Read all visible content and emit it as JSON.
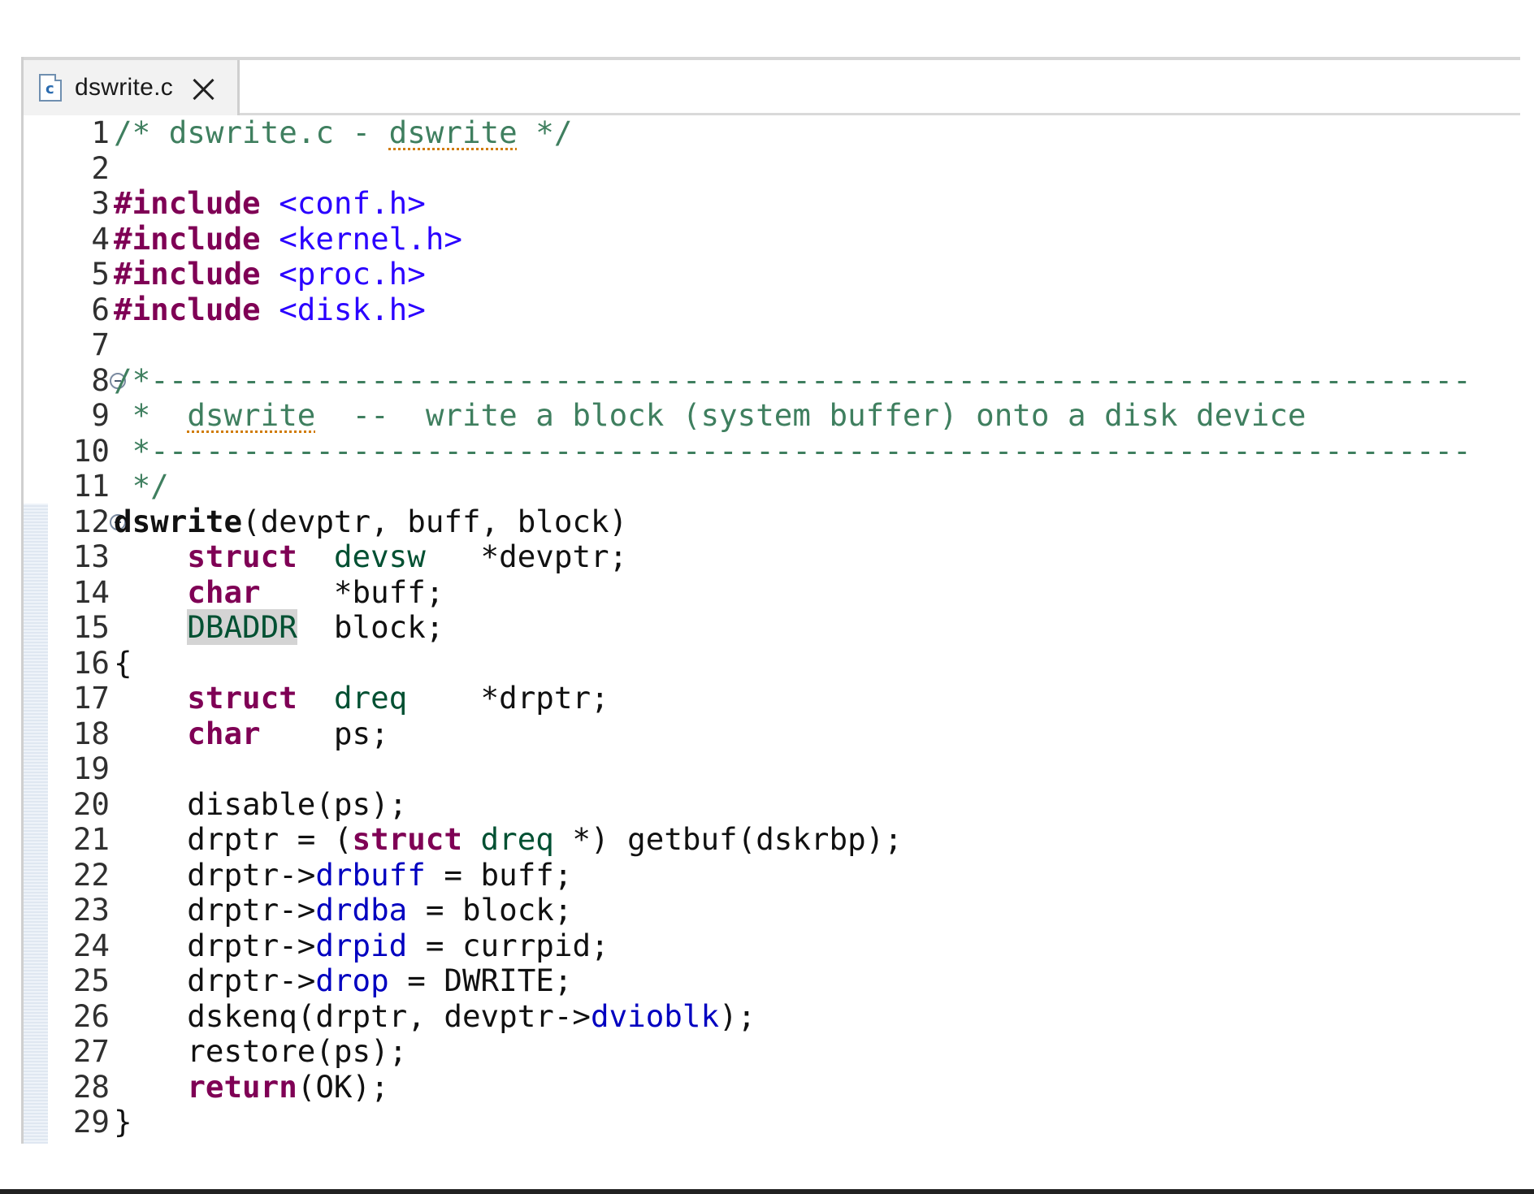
{
  "tab": {
    "filename": "dswrite.c",
    "icon": "c-source-file-icon",
    "close_icon": "close-icon"
  },
  "code": {
    "lines": [
      {
        "n": "1",
        "fold": false,
        "segs": [
          {
            "c": "cm",
            "t": "/* dswrite.c - "
          },
          {
            "c": "cm squig",
            "t": "dswrite"
          },
          {
            "c": "cm",
            "t": " */"
          }
        ]
      },
      {
        "n": "2",
        "fold": false,
        "segs": []
      },
      {
        "n": "3",
        "fold": false,
        "segs": [
          {
            "c": "kw",
            "t": "#include"
          },
          {
            "c": "",
            "t": " "
          },
          {
            "c": "inc",
            "t": "<conf.h>"
          }
        ]
      },
      {
        "n": "4",
        "fold": false,
        "segs": [
          {
            "c": "kw",
            "t": "#include"
          },
          {
            "c": "",
            "t": " "
          },
          {
            "c": "inc",
            "t": "<kernel.h>"
          }
        ]
      },
      {
        "n": "5",
        "fold": false,
        "segs": [
          {
            "c": "kw",
            "t": "#include"
          },
          {
            "c": "",
            "t": " "
          },
          {
            "c": "inc",
            "t": "<proc.h>"
          }
        ]
      },
      {
        "n": "6",
        "fold": false,
        "segs": [
          {
            "c": "kw",
            "t": "#include"
          },
          {
            "c": "",
            "t": " "
          },
          {
            "c": "inc",
            "t": "<disk.h>"
          }
        ]
      },
      {
        "n": "7",
        "fold": false,
        "segs": []
      },
      {
        "n": "8",
        "fold": true,
        "segs": [
          {
            "c": "cm",
            "t": "/*------------------------------------------------------------------------"
          }
        ]
      },
      {
        "n": "9",
        "fold": false,
        "segs": [
          {
            "c": "cm",
            "t": " *  "
          },
          {
            "c": "cm squig",
            "t": "dswrite"
          },
          {
            "c": "cm",
            "t": "  --  write a block (system buffer) onto a disk device"
          }
        ]
      },
      {
        "n": "10",
        "fold": false,
        "segs": [
          {
            "c": "cm",
            "t": " *------------------------------------------------------------------------"
          }
        ]
      },
      {
        "n": "11",
        "fold": false,
        "segs": [
          {
            "c": "cm",
            "t": " */"
          }
        ]
      },
      {
        "n": "12",
        "fold": true,
        "segs": [
          {
            "c": "bold",
            "t": "dswrite"
          },
          {
            "c": "",
            "t": "(devptr, buff, block)"
          }
        ]
      },
      {
        "n": "13",
        "fold": false,
        "segs": [
          {
            "c": "",
            "t": "    "
          },
          {
            "c": "kw",
            "t": "struct"
          },
          {
            "c": "",
            "t": "  "
          },
          {
            "c": "typ",
            "t": "devsw"
          },
          {
            "c": "",
            "t": "   *devptr;"
          }
        ]
      },
      {
        "n": "14",
        "fold": false,
        "segs": [
          {
            "c": "",
            "t": "    "
          },
          {
            "c": "kw",
            "t": "char"
          },
          {
            "c": "",
            "t": "    *buff;"
          }
        ]
      },
      {
        "n": "15",
        "fold": false,
        "segs": [
          {
            "c": "",
            "t": "    "
          },
          {
            "c": "typhl",
            "t": "DBADDR"
          },
          {
            "c": "",
            "t": "  block;"
          }
        ]
      },
      {
        "n": "16",
        "fold": false,
        "segs": [
          {
            "c": "",
            "t": "{"
          }
        ]
      },
      {
        "n": "17",
        "fold": false,
        "segs": [
          {
            "c": "",
            "t": "    "
          },
          {
            "c": "kw",
            "t": "struct"
          },
          {
            "c": "",
            "t": "  "
          },
          {
            "c": "typ",
            "t": "dreq"
          },
          {
            "c": "",
            "t": "    *drptr;"
          }
        ]
      },
      {
        "n": "18",
        "fold": false,
        "segs": [
          {
            "c": "",
            "t": "    "
          },
          {
            "c": "kw",
            "t": "char"
          },
          {
            "c": "",
            "t": "    ps;"
          }
        ]
      },
      {
        "n": "19",
        "fold": false,
        "segs": []
      },
      {
        "n": "20",
        "fold": false,
        "segs": [
          {
            "c": "",
            "t": "    disable(ps);"
          }
        ]
      },
      {
        "n": "21",
        "fold": false,
        "segs": [
          {
            "c": "",
            "t": "    drptr = ("
          },
          {
            "c": "kw",
            "t": "struct"
          },
          {
            "c": "",
            "t": " "
          },
          {
            "c": "typ",
            "t": "dreq"
          },
          {
            "c": "",
            "t": " *) getbuf(dskrbp);"
          }
        ]
      },
      {
        "n": "22",
        "fold": false,
        "segs": [
          {
            "c": "",
            "t": "    drptr->"
          },
          {
            "c": "fld",
            "t": "drbuff"
          },
          {
            "c": "",
            "t": " = buff;"
          }
        ]
      },
      {
        "n": "23",
        "fold": false,
        "segs": [
          {
            "c": "",
            "t": "    drptr->"
          },
          {
            "c": "fld",
            "t": "drdba"
          },
          {
            "c": "",
            "t": " = block;"
          }
        ]
      },
      {
        "n": "24",
        "fold": false,
        "segs": [
          {
            "c": "",
            "t": "    drptr->"
          },
          {
            "c": "fld",
            "t": "drpid"
          },
          {
            "c": "",
            "t": " = currpid;"
          }
        ]
      },
      {
        "n": "25",
        "fold": false,
        "segs": [
          {
            "c": "",
            "t": "    drptr->"
          },
          {
            "c": "fld",
            "t": "drop"
          },
          {
            "c": "",
            "t": " = DWRITE;"
          }
        ]
      },
      {
        "n": "26",
        "fold": false,
        "segs": [
          {
            "c": "",
            "t": "    dskenq(drptr, devptr->"
          },
          {
            "c": "fld",
            "t": "dvioblk"
          },
          {
            "c": "",
            "t": ");"
          }
        ]
      },
      {
        "n": "27",
        "fold": false,
        "segs": [
          {
            "c": "",
            "t": "    restore(ps);"
          }
        ]
      },
      {
        "n": "28",
        "fold": false,
        "segs": [
          {
            "c": "",
            "t": "    "
          },
          {
            "c": "kw",
            "t": "return"
          },
          {
            "c": "",
            "t": "(OK);"
          }
        ]
      },
      {
        "n": "29",
        "fold": false,
        "segs": [
          {
            "c": "",
            "t": "}"
          }
        ]
      }
    ]
  }
}
